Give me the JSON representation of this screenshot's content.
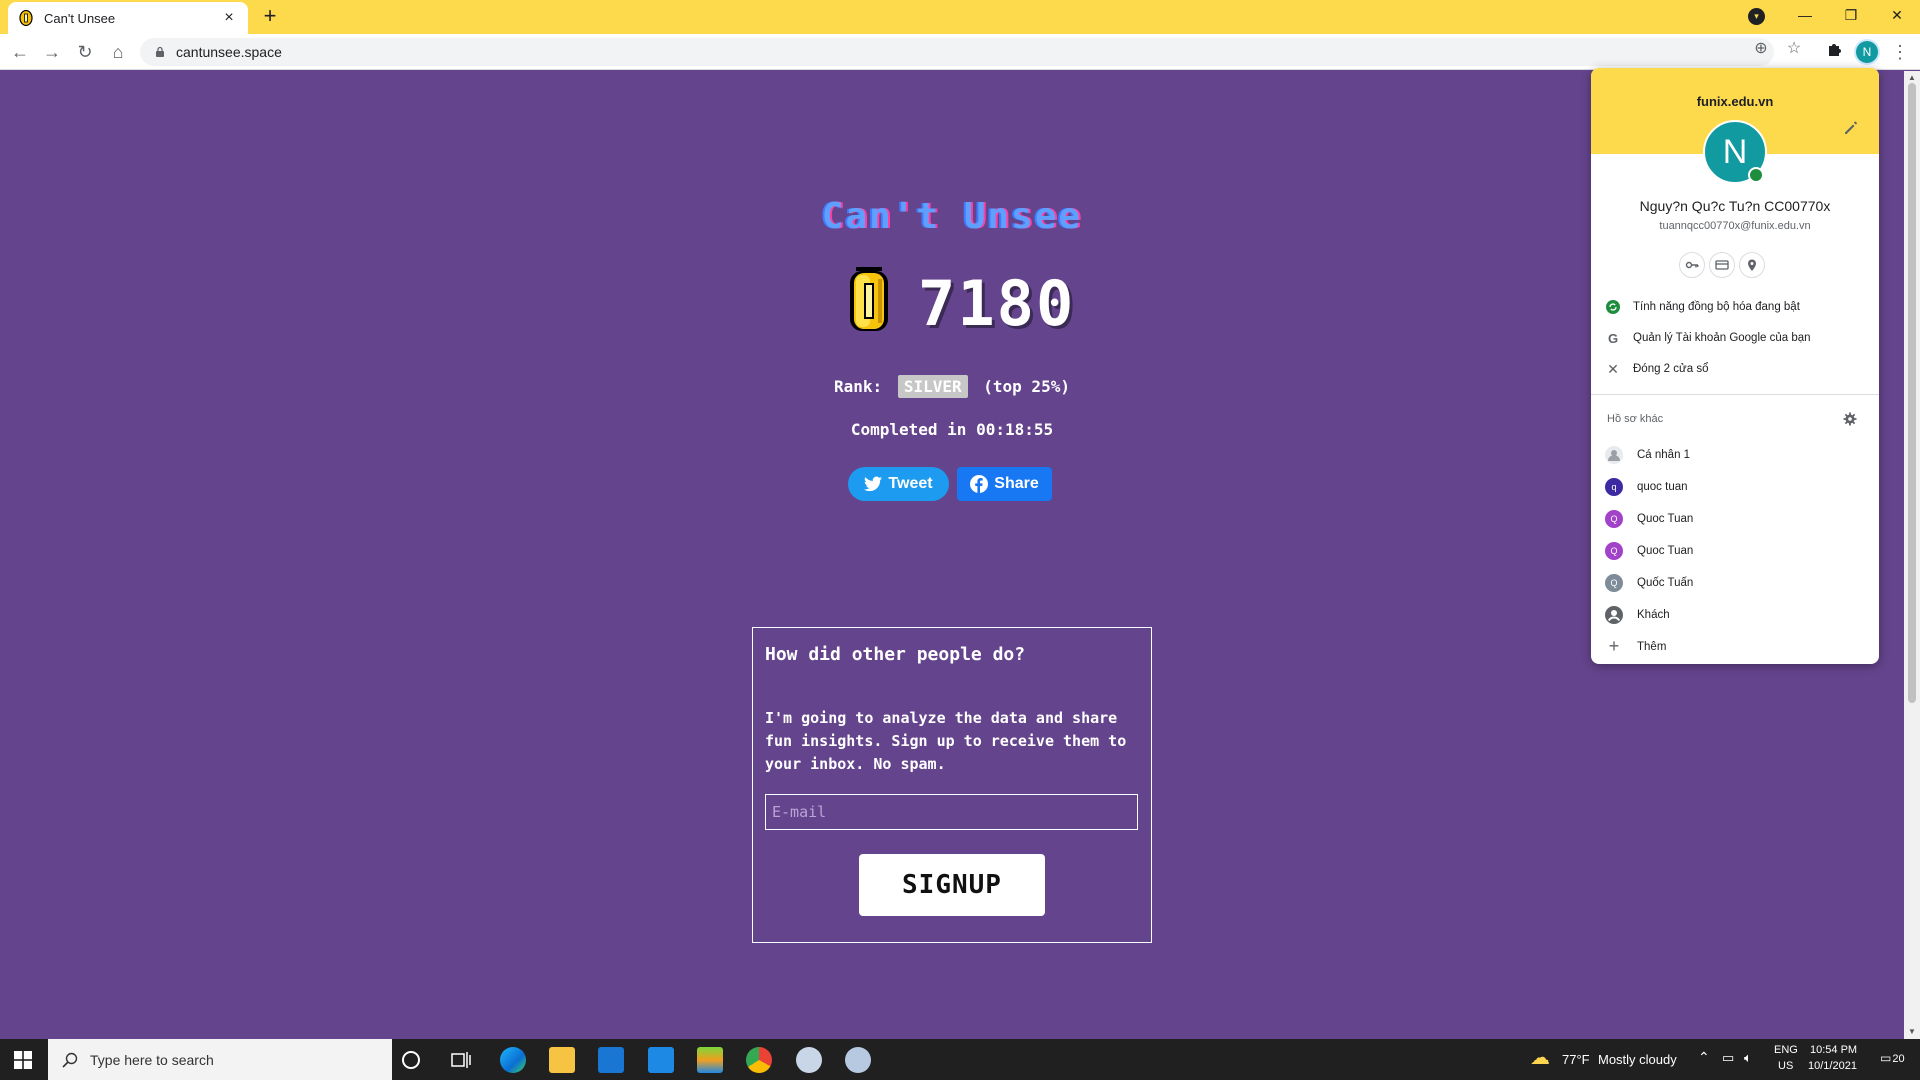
{
  "browser": {
    "tab_title": "Can't Unsee",
    "tab_close": "×",
    "new_tab": "+",
    "url": "cantunsee.space",
    "profile_initial": "N"
  },
  "game": {
    "title": "Can't Unsee",
    "score": "7180",
    "rank_label": "Rank:",
    "rank_value": "SILVER",
    "rank_top": "(top 25%)",
    "completed": "Completed in 00:18:55",
    "tweet_label": "Tweet",
    "share_label": "Share"
  },
  "signup": {
    "question": "How did other people do?",
    "description": "I'm going to analyze the data and share fun insights. Sign up to receive them to your inbox. No spam.",
    "email_placeholder": "E-mail",
    "button_label": "SIGNUP"
  },
  "profile_menu": {
    "domain": "funix.edu.vn",
    "avatar_initial": "N",
    "name": "Nguy?n Qu?c Tu?n CC00770x",
    "email": "tuannqcc00770x@funix.edu.vn",
    "actions": [
      {
        "label": "Tính năng đồng bộ hóa đang bật",
        "icon": "sync-icon"
      },
      {
        "label": "Quản lý Tài khoản Google của bạn",
        "icon": "google-icon"
      },
      {
        "label": "Đóng 2 cửa sổ",
        "icon": "close-icon"
      }
    ],
    "other_profiles_label": "Hồ sơ khác",
    "profiles": [
      {
        "label": "Cá nhân 1",
        "initial": "",
        "color": "#9aa0a6"
      },
      {
        "label": "quoc tuan",
        "initial": "q",
        "color": "#3c2aa3"
      },
      {
        "label": "Quoc Tuan",
        "initial": "Q",
        "color": "#a142c9"
      },
      {
        "label": "Quoc Tuan",
        "initial": "Q",
        "color": "#a142c9"
      },
      {
        "label": "Quốc Tuấn",
        "initial": "Q",
        "color": "#7e8c99"
      },
      {
        "label": "Khách",
        "initial": "",
        "color": "#5f6368"
      },
      {
        "label": "Thêm",
        "initial": "+",
        "color": "#ffffff"
      }
    ]
  },
  "taskbar": {
    "search_placeholder": "Type here to search",
    "weather_temp": "77°F",
    "weather_text": "Mostly cloudy",
    "lang": "ENG",
    "region": "US",
    "time": "10:54 PM",
    "date": "10/1/2021",
    "notif_count": "20"
  },
  "colors": {
    "page_bg": "#64448c",
    "tab_strip": "#fdd94c",
    "tweet": "#1d9bf0",
    "facebook": "#1877f2",
    "avatar": "#119aa0"
  }
}
